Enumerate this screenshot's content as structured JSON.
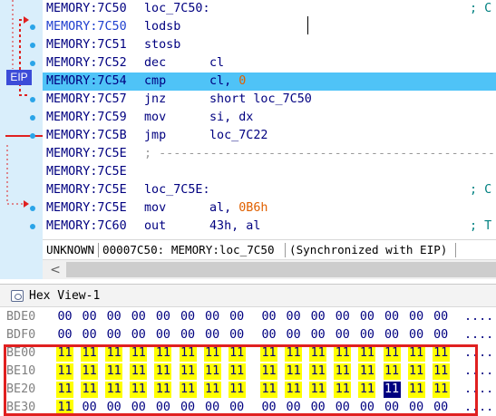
{
  "disasm": {
    "lines": [
      {
        "addr": "MEMORY:7C50",
        "label": "loc_7C50:",
        "comment": "; C",
        "addr_blue": false,
        "highlight": false
      },
      {
        "addr": "MEMORY:7C50",
        "mnemonic": "lodsb",
        "addr_blue": true,
        "highlight": false
      },
      {
        "addr": "MEMORY:7C51",
        "mnemonic": "stosb",
        "addr_blue": false,
        "highlight": false
      },
      {
        "addr": "MEMORY:7C52",
        "mnemonic": "dec",
        "operand": "cl",
        "addr_blue": false,
        "highlight": false
      },
      {
        "addr": "MEMORY:7C54",
        "mnemonic": "cmp",
        "operand": "cl, ",
        "operand_num": "0",
        "addr_blue": false,
        "highlight": true
      },
      {
        "addr": "MEMORY:7C57",
        "mnemonic": "jnz",
        "operand": "short loc_7C50",
        "addr_blue": false,
        "highlight": false
      },
      {
        "addr": "MEMORY:7C59",
        "mnemonic": "mov",
        "operand": "si, dx",
        "addr_blue": false,
        "highlight": false
      },
      {
        "addr": "MEMORY:7C5B",
        "mnemonic": "jmp",
        "operand": "loc_7C22",
        "addr_blue": false,
        "highlight": false
      },
      {
        "addr": "MEMORY:7C5E",
        "separator": "; ---------------------------------------------------",
        "addr_blue": false,
        "highlight": false
      },
      {
        "addr": "MEMORY:7C5E",
        "addr_blue": false,
        "highlight": false
      },
      {
        "addr": "MEMORY:7C5E",
        "label": "loc_7C5E:",
        "comment": "; C",
        "addr_blue": false,
        "highlight": false
      },
      {
        "addr": "MEMORY:7C5E",
        "mnemonic": "mov",
        "operand": "al, ",
        "operand_num": "0B6h",
        "addr_blue": false,
        "highlight": false
      },
      {
        "addr": "MEMORY:7C60",
        "mnemonic": "out",
        "operand": "43h, al",
        "comment": "; T",
        "addr_blue": false,
        "highlight": false
      }
    ],
    "eip_badge": "EIP"
  },
  "status": {
    "state": "UNKNOWN",
    "location": "00007C50: MEMORY:loc_7C50",
    "sync": "(Synchronized with EIP)"
  },
  "scrollbar": {
    "left_arrow": "<"
  },
  "hexview": {
    "title": "Hex View-1",
    "rows": [
      {
        "addr": "BDE0",
        "bytes": [
          "00",
          "00",
          "00",
          "00",
          "00",
          "00",
          "00",
          "00",
          "00",
          "00",
          "00",
          "00",
          "00",
          "00",
          "00",
          "00"
        ],
        "changed": [],
        "ascii": "...."
      },
      {
        "addr": "BDF0",
        "bytes": [
          "00",
          "00",
          "00",
          "00",
          "00",
          "00",
          "00",
          "00",
          "00",
          "00",
          "00",
          "00",
          "00",
          "00",
          "00",
          "00"
        ],
        "changed": [],
        "ascii": "...."
      },
      {
        "addr": "BE00",
        "bytes": [
          "11",
          "11",
          "11",
          "11",
          "11",
          "11",
          "11",
          "11",
          "11",
          "11",
          "11",
          "11",
          "11",
          "11",
          "11",
          "11"
        ],
        "changed": [
          0,
          1,
          2,
          3,
          4,
          5,
          6,
          7,
          8,
          9,
          10,
          11,
          12,
          13,
          14,
          15
        ],
        "ascii": "...."
      },
      {
        "addr": "BE10",
        "bytes": [
          "11",
          "11",
          "11",
          "11",
          "11",
          "11",
          "11",
          "11",
          "11",
          "11",
          "11",
          "11",
          "11",
          "11",
          "11",
          "11"
        ],
        "changed": [
          0,
          1,
          2,
          3,
          4,
          5,
          6,
          7,
          8,
          9,
          10,
          11,
          12,
          13,
          14,
          15
        ],
        "ascii": "...."
      },
      {
        "addr": "BE20",
        "bytes": [
          "11",
          "11",
          "11",
          "11",
          "11",
          "11",
          "11",
          "11",
          "11",
          "11",
          "11",
          "11",
          "11",
          "11",
          "11",
          "11"
        ],
        "changed": [
          0,
          1,
          2,
          3,
          4,
          5,
          6,
          7,
          8,
          9,
          10,
          11,
          12,
          14,
          15
        ],
        "cursor": 13,
        "ascii": "...."
      },
      {
        "addr": "BE30",
        "bytes": [
          "11",
          "00",
          "00",
          "00",
          "00",
          "00",
          "00",
          "00",
          "00",
          "00",
          "00",
          "00",
          "00",
          "00",
          "00",
          "00"
        ],
        "changed": [
          0
        ],
        "ascii": "...."
      }
    ]
  },
  "colors": {
    "highlight_row": "#4fc3f7",
    "gutter": "#d9eefb",
    "eip_badge": "#3c4cd8",
    "changed_byte": "#ffff00",
    "selection_border": "#e02020"
  }
}
